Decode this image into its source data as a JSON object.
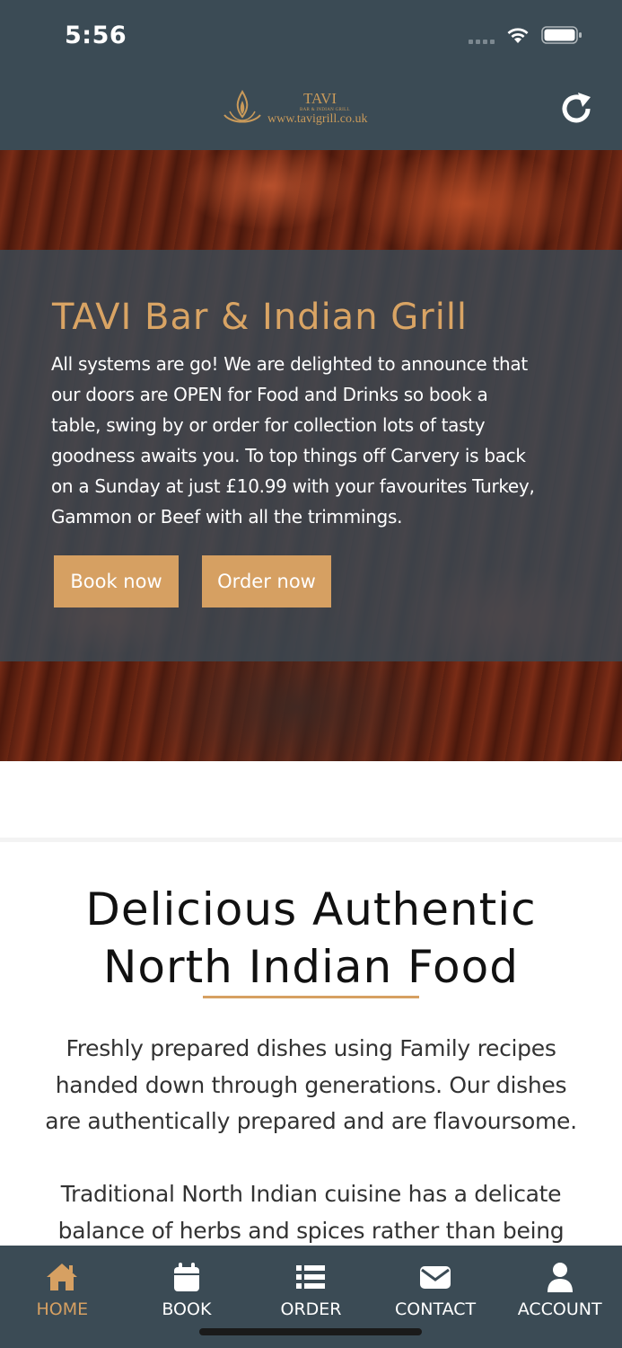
{
  "status_bar": {
    "time": "5:56"
  },
  "header": {
    "logo_name": "TAVI",
    "logo_tagline": "BAR & INDIAN GRILL",
    "logo_url": "www.tavigrill.co.uk",
    "refresh_icon": "refresh-icon"
  },
  "hero": {
    "title": "TAVI Bar & Indian Grill",
    "text_lines": [
      "All systems are go! We are delighted to announce that",
      "our doors are OPEN for Food and Drinks so book a",
      "table, swing by or order for collection lots of tasty",
      "goodness awaits you. To top things off Carvery is back",
      "on a Sunday at just £10.99 with your favourites Turkey,",
      "Gammon or Beef with all the trimmings."
    ],
    "book_label": "Book now",
    "order_label": "Order now"
  },
  "intro": {
    "title_lines": [
      "Delicious Authentic",
      "North Indian Food"
    ],
    "para1_lines": [
      "Freshly prepared dishes using Family recipes",
      "handed down through generations. Our dishes",
      "are authentically prepared and are flavoursome."
    ],
    "para2_lines": [
      "Traditional North Indian cuisine has a delicate",
      "balance of herbs and spices rather than being"
    ]
  },
  "tabs": [
    {
      "label": "HOME",
      "icon": "home-icon",
      "active": true
    },
    {
      "label": "BOOK",
      "icon": "calendar-icon",
      "active": false
    },
    {
      "label": "ORDER",
      "icon": "list-icon",
      "active": false
    },
    {
      "label": "CONTACT",
      "icon": "envelope-icon",
      "active": false
    },
    {
      "label": "ACCOUNT",
      "icon": "user-icon",
      "active": false
    }
  ],
  "colors": {
    "header_bg": "#3b4b55",
    "accent": "#d6a062",
    "tab_active": "#d6a062"
  }
}
